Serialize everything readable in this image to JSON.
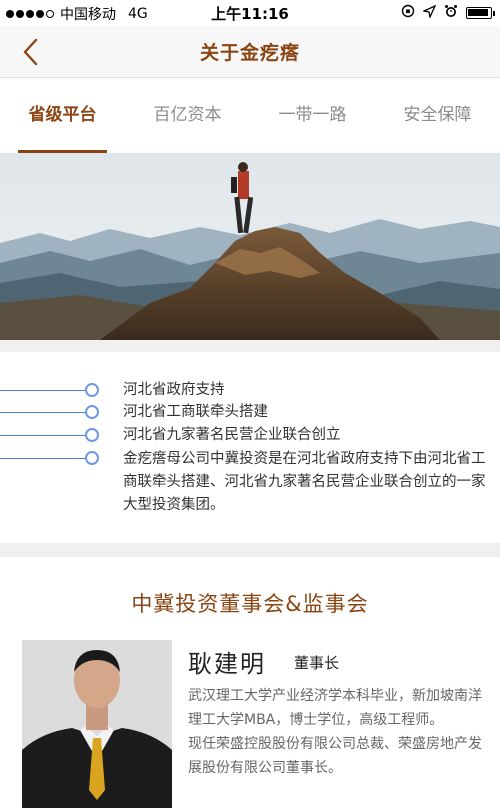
{
  "status_bar": {
    "carrier": "中国移动",
    "network": "4G",
    "time": "上午11:16"
  },
  "nav": {
    "title": "关于金疙瘩"
  },
  "tabs": [
    {
      "label": "省级平台",
      "active": true
    },
    {
      "label": "百亿资本",
      "active": false
    },
    {
      "label": "一带一路",
      "active": false
    },
    {
      "label": "安全保障",
      "active": false
    }
  ],
  "points": [
    "河北省政府支持",
    "河北省工商联牵头搭建",
    "河北省九家著名民营企业联合创立"
  ],
  "description": "金疙瘩母公司中冀投资是在河北省政府支持下由河北省工商联牵头搭建、河北省九家著名民营企业联合创立的一家大型投资集团。",
  "board": {
    "title": "中冀投资董事会&监事会",
    "member": {
      "name": "耿建明",
      "role": "董事长",
      "bio_1": "武汉理工大学产业经济学本科毕业，新加坡南洋理工大学MBA，博士学位，高级工程师。",
      "bio_2": "现任荣盛控股股份有限公司总裁、荣盛房地产发展股份有限公司董事长。"
    }
  },
  "colors": {
    "accent": "#8b4513",
    "timeline": "#4a7fe0"
  }
}
